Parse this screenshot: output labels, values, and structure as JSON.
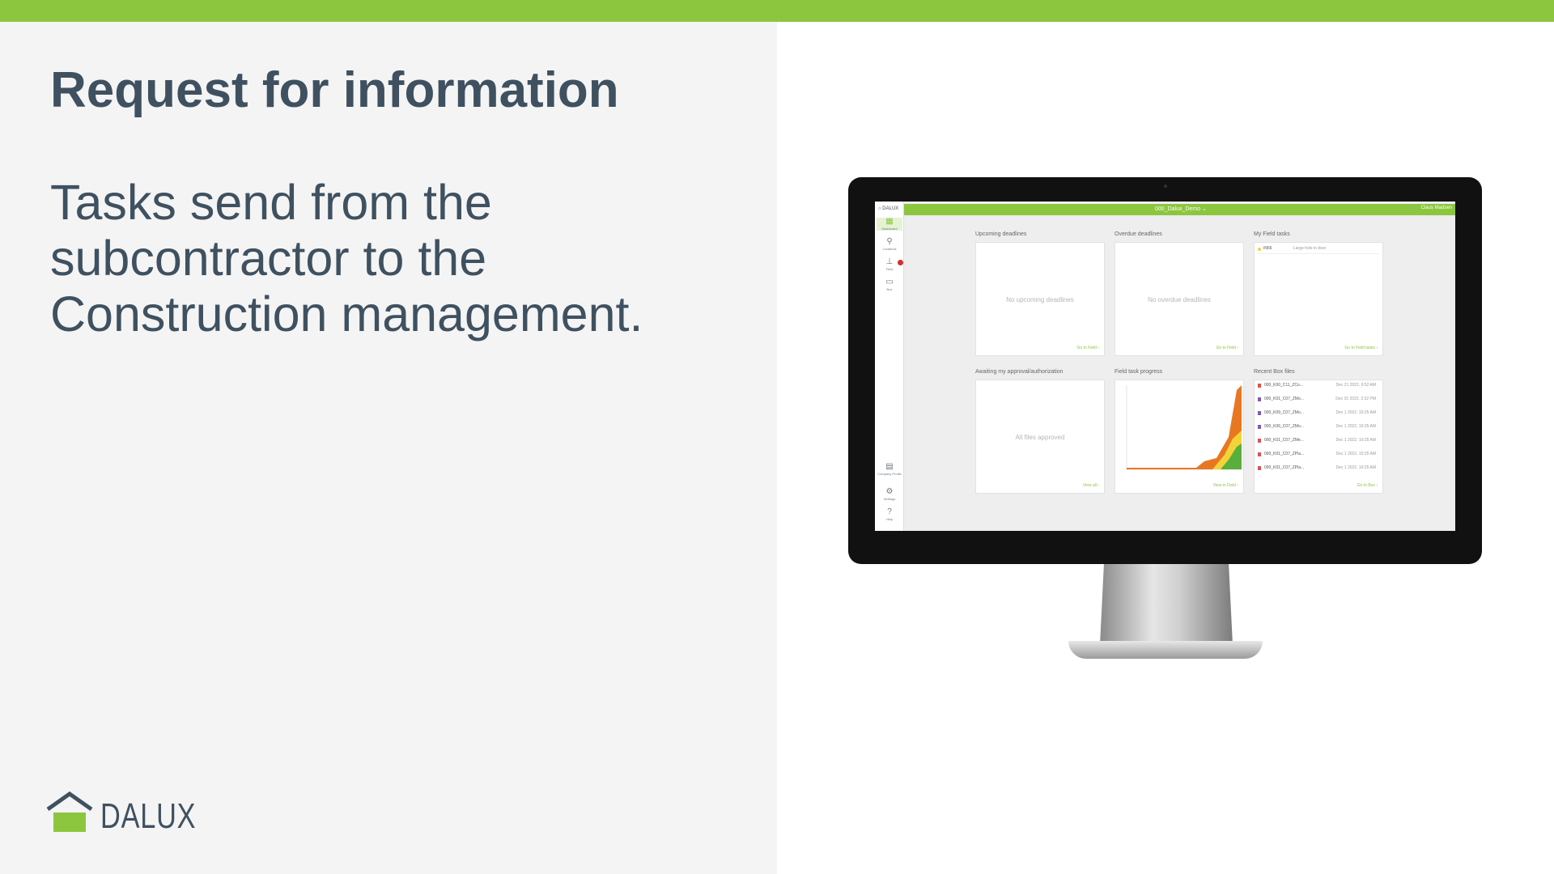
{
  "slide": {
    "title": "Request for information",
    "body_lines": [
      "Tasks send from the",
      "subcontractor to the",
      "Construction management."
    ],
    "logo_text": "DALUX"
  },
  "colors": {
    "accent_green": "#8cc63f",
    "heading_text": "#3f5160",
    "left_panel_bg": "#f4f4f4"
  },
  "app": {
    "logo_text": "DALUX",
    "project_select": "000_Dalux_Demo ⌄",
    "user_name": "Claus Madsen",
    "sidebar": [
      {
        "label": "Dashboard",
        "icon": "grid-icon",
        "glyph": "▦"
      },
      {
        "label": "Locations",
        "icon": "pin-icon",
        "glyph": "⚲"
      },
      {
        "label": "Field",
        "icon": "tool-icon",
        "glyph": "⊥"
      },
      {
        "label": "Box",
        "icon": "box-icon",
        "glyph": "▭"
      },
      {
        "label": "Company Profile",
        "icon": "building-icon",
        "glyph": "▤"
      },
      {
        "label": "Settings",
        "icon": "gear-icon",
        "glyph": "⚙"
      },
      {
        "label": "Help",
        "icon": "help-icon",
        "glyph": "?"
      }
    ],
    "cards": {
      "upcoming": {
        "title": "Upcoming deadlines",
        "empty": "No upcoming deadlines",
        "link": "Go to Field ›"
      },
      "overdue": {
        "title": "Overdue deadlines",
        "empty": "No overdue deadlines",
        "link": "Go to Field ›"
      },
      "my_tasks": {
        "title": "My Field tasks",
        "task_id": "IN56",
        "task_text": "Large hole in door",
        "link": "Go to Field tasks ›"
      },
      "approval": {
        "title": "Awaiting my approval/authorization",
        "empty": "All files approved",
        "link": "View all ›"
      },
      "progress": {
        "title": "Field task progress",
        "link": "View in Field ›"
      },
      "recent": {
        "title": "Recent Box files",
        "link": "Go to Box ›",
        "files": [
          {
            "name": "000_K00_C11_ZCo...",
            "date": "Dec 21 2022, 9:52 AM"
          },
          {
            "name": "000_K01_C07_ZMo...",
            "date": "Dec 15 2022, 2:32 PM"
          },
          {
            "name": "000_K09_C07_ZMo...",
            "date": "Dec 1 2022, 10:25 AM"
          },
          {
            "name": "000_K06_C07_ZMo...",
            "date": "Dec 1 2022, 10:25 AM"
          },
          {
            "name": "000_K01_C07_ZMe...",
            "date": "Dec 1 2022, 10:25 AM"
          },
          {
            "name": "000_K01_C07_ZPla...",
            "date": "Dec 1 2022, 10:25 AM"
          },
          {
            "name": "000_K01_C07_ZPla...",
            "date": "Dec 1 2022, 10:25 AM"
          }
        ]
      }
    }
  }
}
